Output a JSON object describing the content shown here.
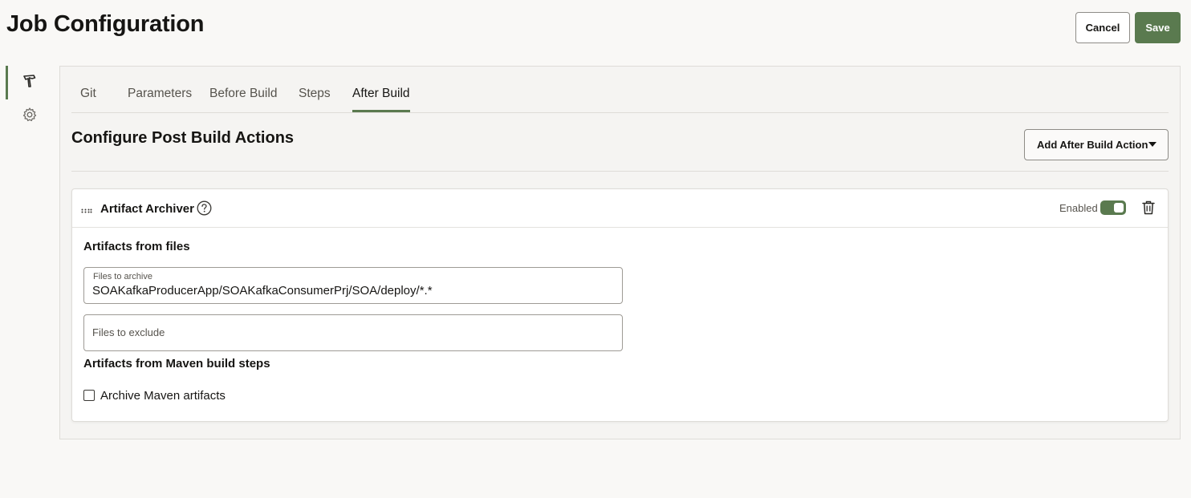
{
  "header": {
    "title": "Job Configuration",
    "cancel_label": "Cancel",
    "save_label": "Save",
    "accent_color": "#5a7a4f"
  },
  "side_nav": {
    "items": [
      {
        "icon": "hammer-icon",
        "active": true
      },
      {
        "icon": "gear-icon",
        "active": false
      }
    ]
  },
  "tabs": [
    {
      "label": "Git",
      "active": false
    },
    {
      "label": "Parameters",
      "active": false
    },
    {
      "label": "Before Build",
      "active": false
    },
    {
      "label": "Steps",
      "active": false
    },
    {
      "label": "After Build",
      "active": true
    }
  ],
  "section": {
    "title": "Configure Post Build Actions",
    "add_action_label": "Add After Build Action"
  },
  "card": {
    "title": "Artifact Archiver",
    "enabled_label": "Enabled",
    "enabled": true,
    "files_heading": "Artifacts from files",
    "archive_field": {
      "label": "Files to archive",
      "value": "SOAKafkaProducerApp/SOAKafkaConsumerPrj/SOA/deploy/*.*"
    },
    "exclude_field": {
      "placeholder": "Files to exclude",
      "value": ""
    },
    "maven_heading": "Artifacts from Maven build steps",
    "maven_checkbox": {
      "label": "Archive Maven artifacts",
      "checked": false
    }
  }
}
